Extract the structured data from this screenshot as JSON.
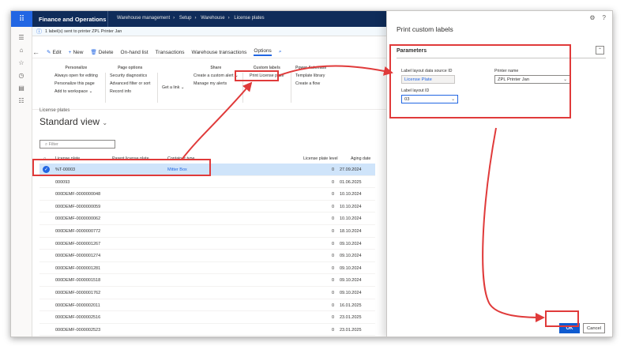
{
  "topbar": {
    "app_name": "Finance and Operations",
    "crumbs": [
      "Warehouse management",
      "Setup",
      "Warehouse",
      "License plates"
    ]
  },
  "infobar": {
    "message": "1 label(s) sent to printer ZPL Printer Jan"
  },
  "actionbar": {
    "edit": "Edit",
    "new": "New",
    "delete": "Delete",
    "onhand": "On-hand list",
    "transactions": "Transactions",
    "wh_transactions": "Warehouse transactions",
    "options": "Options"
  },
  "ribbon": {
    "personalize": {
      "title": "Personalize",
      "items": [
        "Always open for editing",
        "Personalize this page",
        "Add to workspace"
      ]
    },
    "page_options": {
      "title": "Page options",
      "items": [
        "Security diagnostics",
        "Advanced filter or sort",
        "Record info"
      ]
    },
    "share": {
      "title": "Share",
      "get_link": "Get a link",
      "items": [
        "Create a custom alert",
        "Manage my alerts"
      ]
    },
    "custom_labels": {
      "title": "Custom labels",
      "items": [
        "Print License plate"
      ]
    },
    "power_automate": {
      "title": "Power Automate",
      "items": [
        "Template library",
        "Create a flow"
      ]
    }
  },
  "list": {
    "label": "License plates",
    "view_title": "Standard view",
    "filter_placeholder": "Filter",
    "columns": {
      "license_plate": "License plate",
      "parent": "Parent license plate",
      "container": "Container type",
      "level": "License plate level",
      "aging": "Aging date"
    },
    "rows": [
      {
        "lp": "%T-00003",
        "container": "Mitter Box",
        "level": "0",
        "aging": "27.09.2024",
        "selected": true
      },
      {
        "lp": "000093",
        "container": "",
        "level": "0",
        "aging": "01.06.2025"
      },
      {
        "lp": "000DEMF-0000000048",
        "container": "",
        "level": "0",
        "aging": "10.10.2024"
      },
      {
        "lp": "000DEMF-0000000059",
        "container": "",
        "level": "0",
        "aging": "10.10.2024"
      },
      {
        "lp": "000DEMF-0000000062",
        "container": "",
        "level": "0",
        "aging": "10.10.2024"
      },
      {
        "lp": "000DEMF-0000000772",
        "container": "",
        "level": "0",
        "aging": "18.10.2024"
      },
      {
        "lp": "000DEMF-0000001267",
        "container": "",
        "level": "0",
        "aging": "09.10.2024"
      },
      {
        "lp": "000DEMF-0000001274",
        "container": "",
        "level": "0",
        "aging": "09.10.2024"
      },
      {
        "lp": "000DEMF-0000001281",
        "container": "",
        "level": "0",
        "aging": "09.10.2024"
      },
      {
        "lp": "000DEMF-0000001518",
        "container": "",
        "level": "0",
        "aging": "09.10.2024"
      },
      {
        "lp": "000DEMF-0000001762",
        "container": "",
        "level": "0",
        "aging": "09.10.2024"
      },
      {
        "lp": "000DEMF-0000002011",
        "container": "",
        "level": "0",
        "aging": "16.01.2025"
      },
      {
        "lp": "000DEMF-0000002516",
        "container": "",
        "level": "0",
        "aging": "23.01.2025"
      },
      {
        "lp": "000DEMF-0000002523",
        "container": "",
        "level": "0",
        "aging": "23.01.2025"
      }
    ]
  },
  "dialog": {
    "title": "Print custom labels",
    "section": "Parameters",
    "source_label": "Label layout data source ID",
    "source_value": "License Plate",
    "layout_label": "Label layout ID",
    "layout_value": "03",
    "printer_label": "Printer name",
    "printer_value": "ZPL Printer Jan",
    "ok": "OK",
    "cancel": "Cancel"
  },
  "colors": {
    "brand_nav": "#0f2c5a",
    "accent": "#2266e3",
    "highlight": "#e03a3a"
  }
}
